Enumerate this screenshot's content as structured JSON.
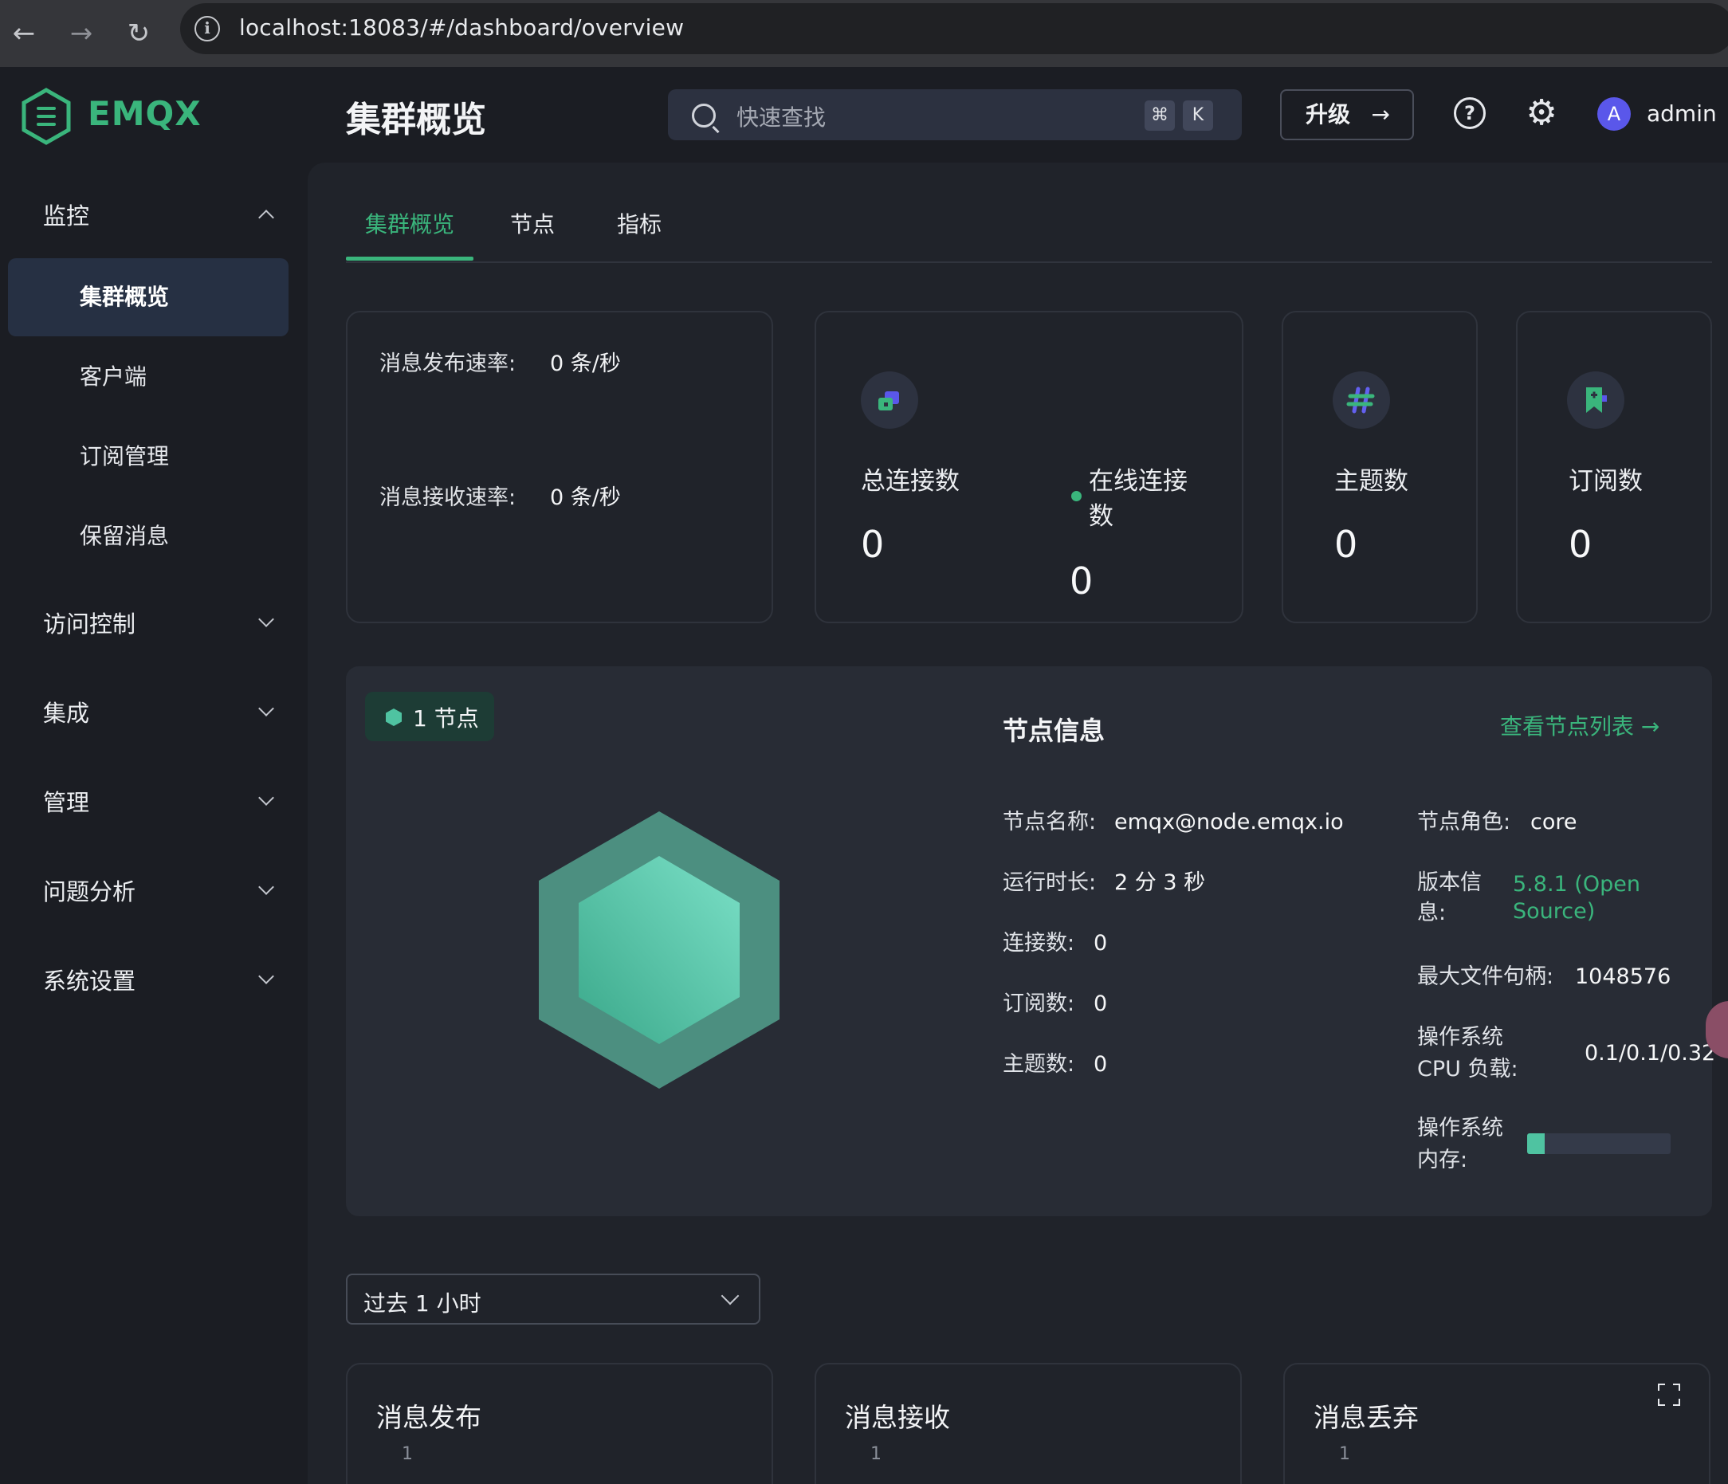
{
  "browser": {
    "url": "localhost:18083/#/dashboard/overview",
    "back": "←",
    "forward": "→",
    "reload": "↻",
    "info": "i"
  },
  "header": {
    "logo_text": "EMQX",
    "page_title": "集群概览",
    "search_placeholder": "快速查找",
    "kbd_cmd": "⌘",
    "kbd_k": "K",
    "upgrade_label": "升级",
    "upgrade_arrow": "→",
    "help": "?",
    "gear": "⚙",
    "avatar_letter": "A",
    "username": "admin"
  },
  "sidebar": {
    "monitor": "监控",
    "monitor_items": [
      "集群概览",
      "客户端",
      "订阅管理",
      "保留消息"
    ],
    "groups": [
      "访问控制",
      "集成",
      "管理",
      "问题分析",
      "系统设置"
    ]
  },
  "tabs": [
    "集群概览",
    "节点",
    "指标"
  ],
  "rates": {
    "publish_label": "消息发布速率:",
    "publish_value": "0 条/秒",
    "receive_label": "消息接收速率:",
    "receive_value": "0 条/秒"
  },
  "stats": {
    "total_conn_label": "总连接数",
    "total_conn_value": "0",
    "online_conn_label_1": "在线连接",
    "online_conn_label_2": "数",
    "online_conn_value": "0",
    "topics_label": "主题数",
    "topics_value": "0",
    "subs_label": "订阅数",
    "subs_value": "0"
  },
  "node": {
    "badge": "1 节点",
    "title": "节点信息",
    "link": "查看节点列表 →",
    "name_label": "节点名称:",
    "name_value": "emqx@node.emqx.io",
    "uptime_label": "运行时长:",
    "uptime_value": "2 分 3 秒",
    "conn_label": "连接数:",
    "conn_value": "0",
    "subs_label": "订阅数:",
    "subs_value": "0",
    "topics_label": "主题数:",
    "topics_value": "0",
    "role_label": "节点角色:",
    "role_value": "core",
    "version_label_1": "版本信",
    "version_label_2": "息:",
    "version_value_1": "5.8.1 (Open",
    "version_value_2": "Source)",
    "fd_label": "最大文件句柄:",
    "fd_value": "1048576",
    "cpu_label_1": "操作系统",
    "cpu_label_2": "CPU 负载:",
    "cpu_value": "0.1/0.1/0.32",
    "mem_label_1": "操作系统",
    "mem_label_2": "内存:",
    "mem_fraction": 0.12
  },
  "time_range": "过去 1 小时",
  "charts": [
    {
      "title": "消息发布",
      "tick": "1"
    },
    {
      "title": "消息接收",
      "tick": "1"
    },
    {
      "title": "消息丢弃",
      "tick": "1"
    }
  ],
  "colors": {
    "accent": "#3ab57c",
    "avatar": "#5a57ea",
    "mem_fill": "#4fc3a1"
  }
}
